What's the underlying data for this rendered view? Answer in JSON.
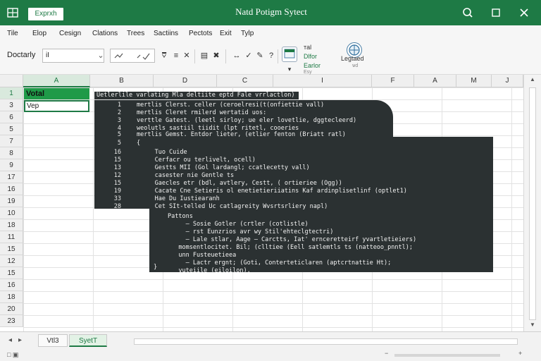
{
  "window": {
    "file_tab": "Exprxh",
    "title": "Natd Potigm Sytect",
    "search_icon": "search-icon",
    "restore_icon": "restore-icon",
    "close_icon": "close-icon"
  },
  "menu": [
    "Tile",
    "Elop",
    "Cesign",
    "Clations",
    "Trees",
    "Sactiins",
    "Pectots",
    "Exit",
    "Tylp"
  ],
  "ribbon": {
    "name_label": "Doctarly",
    "name_box_value": "iI",
    "label_1": "ᴛal",
    "label_2": "Dlfor",
    "label_3": "Earlor",
    "label_4": "Esy",
    "label_5": "Legtaed",
    "label_6": "ѡd"
  },
  "grid": {
    "columns": [
      "A",
      "B",
      "D",
      "C",
      "I",
      "F",
      "A",
      "M",
      "J"
    ],
    "selected_column": "A",
    "rows": [
      "1",
      "3",
      "6",
      "5",
      "7",
      "8",
      "9",
      "17",
      "16",
      "19",
      "10",
      "18",
      "11",
      "15",
      "12",
      "15",
      "16",
      "18",
      "20",
      "23"
    ],
    "cell_a1": "Votal",
    "cell_a2": "Vep"
  },
  "code": {
    "header": "Uetlerlile varlating Mla deltiite eptd Fale vrrlactlon)",
    "lines": [
      {
        "n": "1",
        "t": "mertlis Clerst. celler (ceroelresi(t(onfiettie vall)"
      },
      {
        "n": "2",
        "t": "mertlis Cleret rmilerd wertatid uos:"
      },
      {
        "n": "3",
        "t": "verttle Gatest. (leetl sirloy; ue eler lovetlie, dggtecleerd)"
      },
      {
        "n": "4",
        "t": "weolutls sastiil tiidit (lpt ritetl, cooeries"
      },
      {
        "n": "5",
        "t": "mertlis Gemst. Entdor lieter, (etlier fenton (Briatt ratl)"
      },
      {
        "n": "5",
        "t": "{"
      },
      {
        "n": "16",
        "t": "     Tuo Cuide"
      },
      {
        "n": "15",
        "t": "     Cerfacr ou terlivelt, ocell)"
      },
      {
        "n": "13",
        "t": "     Gestts MII (Gol lardangl; ccatlecetty vall)"
      },
      {
        "n": "12",
        "t": "     casester nie Gentle ts"
      },
      {
        "n": "15",
        "t": "     Gaecles etr (bdl, avtlery, Cestt, ( ortieriee (Ogg))"
      },
      {
        "n": "19",
        "t": "     Cacate Cne Setieris ol enetietieriiatins Kaf ardinplisetlinf (optlet1)"
      },
      {
        "n": "33",
        "t": "     Hae Du Iustiearanh"
      },
      {
        "n": "28",
        "t": "     Cet SIt-telled Uc catlagreity Wvsrtsrliery napl)"
      }
    ],
    "sub_lines": [
      "Pattons",
      "     – Sosie Gotler (crtler (cotlistle)",
      "     – rst Eunzrios avr wy Stil'ehteclgtectri)",
      "     – Lale stlar, Aage – Carctts, Iat' ernceretteirf yvartletieiers)",
      "   momsentlocitet. Bil; (clltiee (Eell satlemtls ts (natteoo_pnntl);",
      "   unn Fusteuetieea",
      "     – Lactr ergnt; (Goti, Conterteticlaren (aptcrtnattie Ht);",
      "   vuteiile (eiloilon)."
    ],
    "closing": "}"
  },
  "tabs": {
    "prev": "◂",
    "next": "▸",
    "sheet1": "Vtl3",
    "sheet2": "SyetT"
  },
  "status": {
    "left": "□ ▣",
    "minus": "−",
    "plus": "+"
  },
  "colors": {
    "accent": "#1e7a45",
    "cell_fill": "#1f9a48",
    "code_bg": "#2b3132"
  }
}
